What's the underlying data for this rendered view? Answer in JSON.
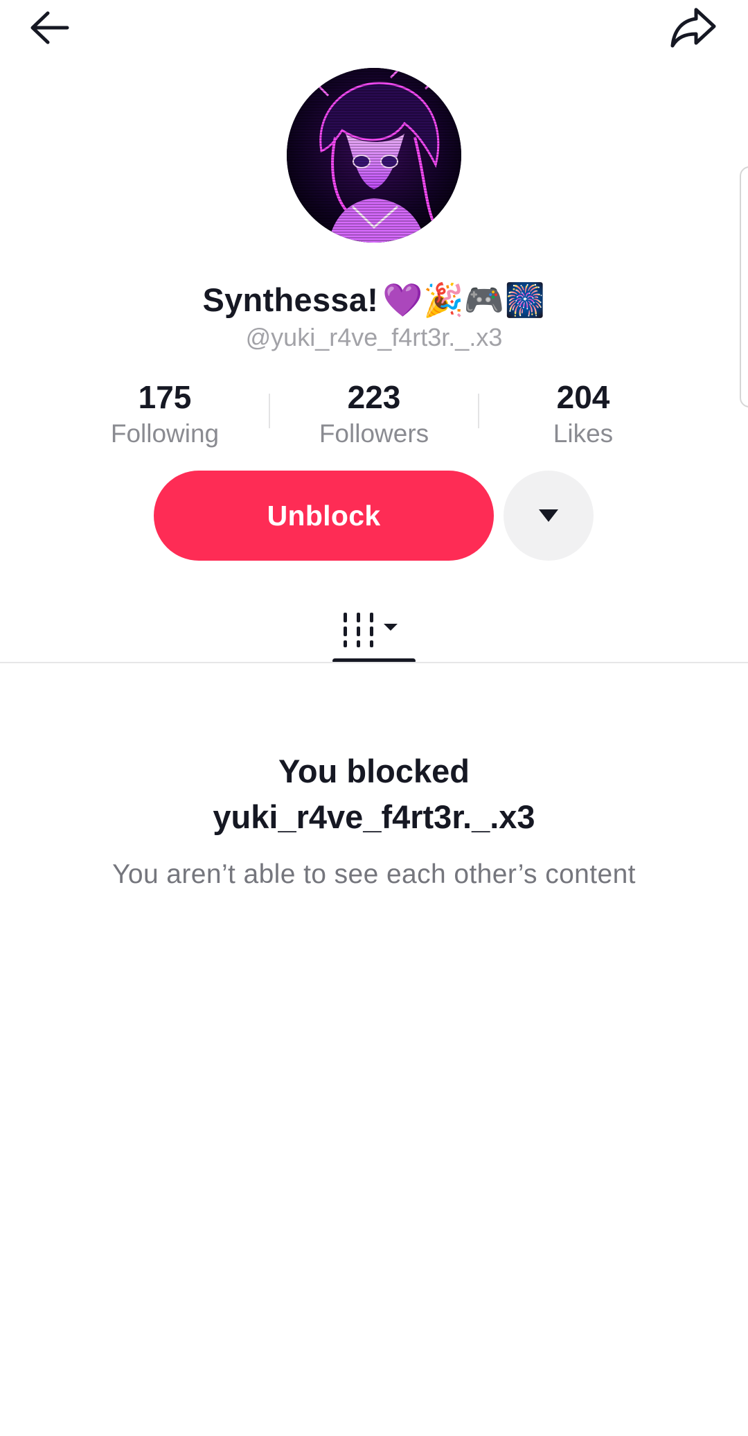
{
  "profile": {
    "display_name": "Synthessa!",
    "display_emojis": "💜🎉🎮🎆",
    "username": "@yuki_r4ve_f4rt3r._.x3"
  },
  "stats": [
    {
      "value": "175",
      "label": "Following"
    },
    {
      "value": "223",
      "label": "Followers"
    },
    {
      "value": "204",
      "label": "Likes"
    }
  ],
  "actions": {
    "unblock_label": "Unblock"
  },
  "icons": {
    "back": "back-arrow-icon",
    "share": "share-icon",
    "more": "caret-down-icon",
    "videos_tab": "video-grid-icon"
  },
  "blocked": {
    "title_line1": "You blocked",
    "title_line2": "yuki_r4ve_f4rt3r._.x3",
    "subtitle": "You aren’t able to see each other’s content"
  },
  "colors": {
    "accent": "#fe2c55",
    "text_primary": "#161823",
    "text_secondary": "#8a8b91",
    "button_secondary_bg": "#f1f1f2"
  }
}
